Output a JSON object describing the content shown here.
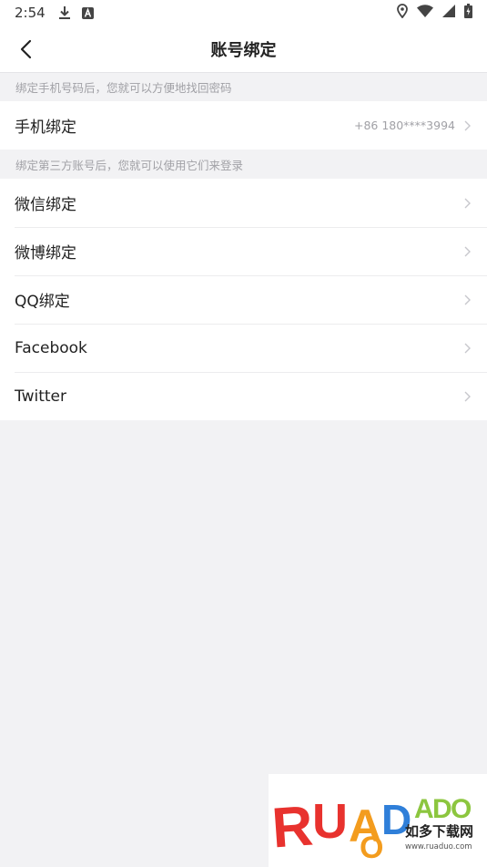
{
  "status_bar": {
    "time": "2:54",
    "icons": [
      "download-icon",
      "a-icon",
      "location-icon",
      "wifi-icon",
      "signal-icon",
      "battery-icon"
    ]
  },
  "header": {
    "title": "账号绑定"
  },
  "phone_section": {
    "hint": "绑定手机号码后，您就可以方便地找回密码",
    "items": [
      {
        "label": "手机绑定",
        "value": "+86 180****3994"
      }
    ]
  },
  "third_party_section": {
    "hint": "绑定第三方账号后，您就可以使用它们来登录",
    "items": [
      {
        "label": "微信绑定"
      },
      {
        "label": "微博绑定"
      },
      {
        "label": "QQ绑定"
      },
      {
        "label": "Facebook"
      },
      {
        "label": "Twitter"
      }
    ]
  },
  "watermark": {
    "brand": "RUANDUO",
    "tagline": "如多下载网",
    "url": "www.ruaduo.com"
  },
  "colors": {
    "background": "#f2f2f4",
    "surface": "#ffffff",
    "text_primary": "#222222",
    "text_secondary": "#a1a1a6",
    "divider": "#ececee",
    "watermark_red": "#e8322e",
    "watermark_orange": "#f39c1e",
    "watermark_green": "#8cc63f",
    "watermark_blue": "#2f7fd9"
  }
}
